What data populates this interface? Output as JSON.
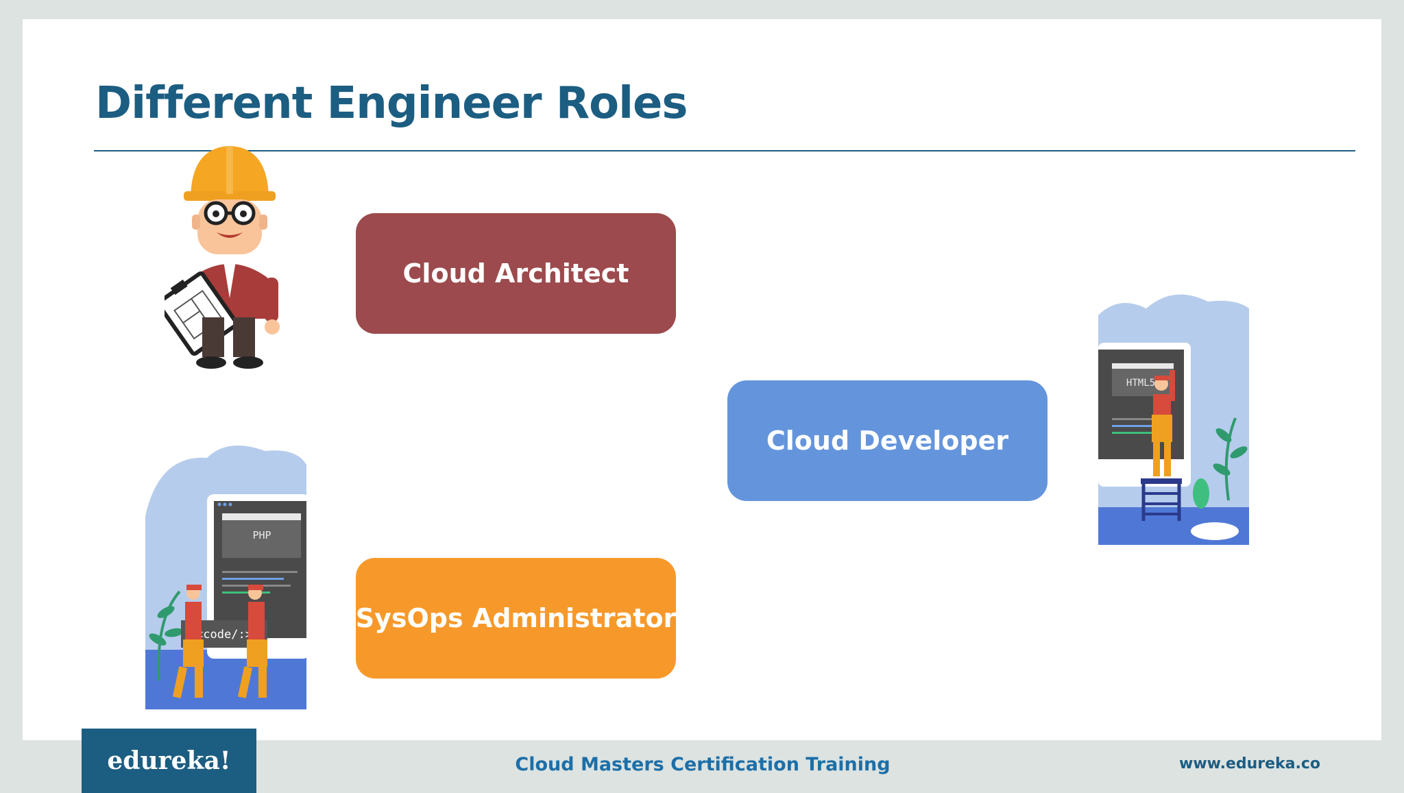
{
  "slide": {
    "title": "Different Engineer Roles"
  },
  "roles": [
    {
      "label": "Cloud Architect",
      "color": "#9c4a4d"
    },
    {
      "label": "Cloud Developer",
      "color": "#6495dc"
    },
    {
      "label": "SysOps Administrator",
      "color": "#f7992a"
    }
  ],
  "illustrations": {
    "architect": {
      "icon": "engineer-with-blueprint-icon"
    },
    "developer": {
      "icon": "developer-html5-screen-icon",
      "screen_text": "HTML5"
    },
    "sysops": {
      "icon": "workers-carrying-code-icon",
      "screen_text": "PHP",
      "board_text": "<code/:>"
    }
  },
  "footer": {
    "logo": "edureka!",
    "course": "Cloud Masters Certification Training",
    "url": "www.edureka.co"
  },
  "colors": {
    "brand": "#1c5d82",
    "background": "#dde3e1"
  }
}
